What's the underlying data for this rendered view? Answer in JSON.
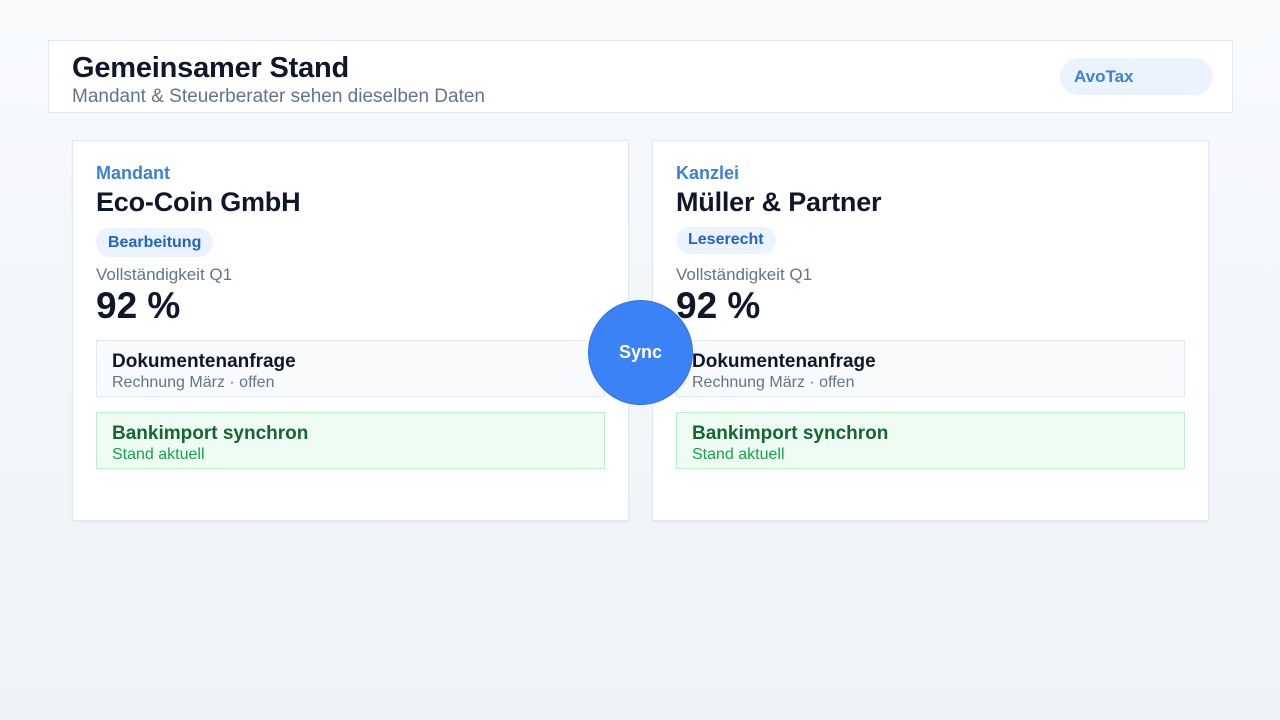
{
  "header": {
    "title": "Gemeinsamer Stand",
    "subtitle": "Mandant & Steuerberater sehen dieselben Daten",
    "brand": "AvoTax"
  },
  "cards": [
    {
      "role": "Mandant",
      "organization": "Eco-Coin GmbH",
      "badge": "Bearbeitung",
      "metric_label": "Vollständigkeit Q1",
      "metric_value": "92 %",
      "request_title": "Dokumentenanfrage",
      "request_detail": "Rechnung März · offen",
      "bank_title": "Bankimport synchron",
      "bank_detail": "Stand aktuell"
    },
    {
      "role": "Kanzlei",
      "organization": "Müller & Partner",
      "badge": "Leserecht",
      "metric_label": "Vollständigkeit Q1",
      "metric_value": "92 %",
      "request_title": "Dokumentenanfrage",
      "request_detail": "Rechnung März · offen",
      "bank_title": "Bankimport synchron",
      "bank_detail": "Stand aktuell"
    }
  ],
  "sync_label": "Sync",
  "colors": {
    "accent": "#3b82f6",
    "success_bg": "#effcf3",
    "success_text": "#166534",
    "text_primary": "#0f172a",
    "text_muted": "#64748b"
  }
}
